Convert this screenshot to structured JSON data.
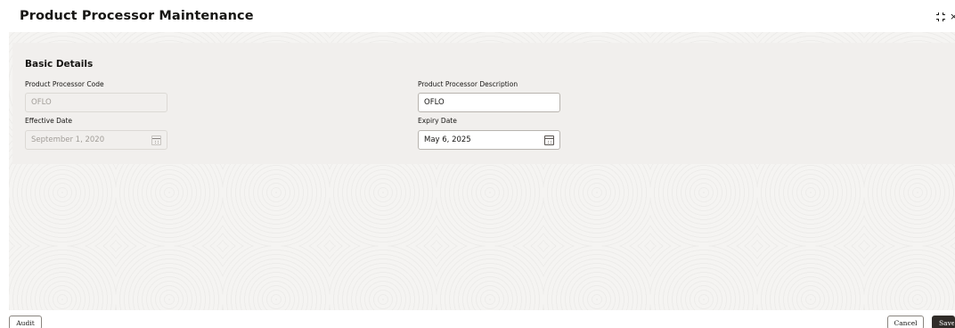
{
  "header": {
    "title": "Product Processor Maintenance",
    "icons": [
      "expand-icon",
      "close-icon"
    ],
    "close_glyph": "×"
  },
  "basic_details": {
    "section_title": "Basic Details",
    "product_processor_code": {
      "label": "Product Processor Code",
      "value": "OFLO",
      "disabled": true
    },
    "product_processor_description": {
      "label": "Product Processor Description",
      "value": "OFLO"
    },
    "effective_date": {
      "label": "Effective Date",
      "value": "September 1, 2020",
      "disabled": true
    },
    "expiry_date": {
      "label": "Expiry Date",
      "value": "May 6, 2025"
    }
  },
  "footer": {
    "audit_label": "Audit",
    "cancel_label": "Cancel",
    "save_label": "Save"
  },
  "colors": {
    "primary_button": "#312d2a",
    "panel_bg": "#f1efed",
    "text": "#161513"
  }
}
